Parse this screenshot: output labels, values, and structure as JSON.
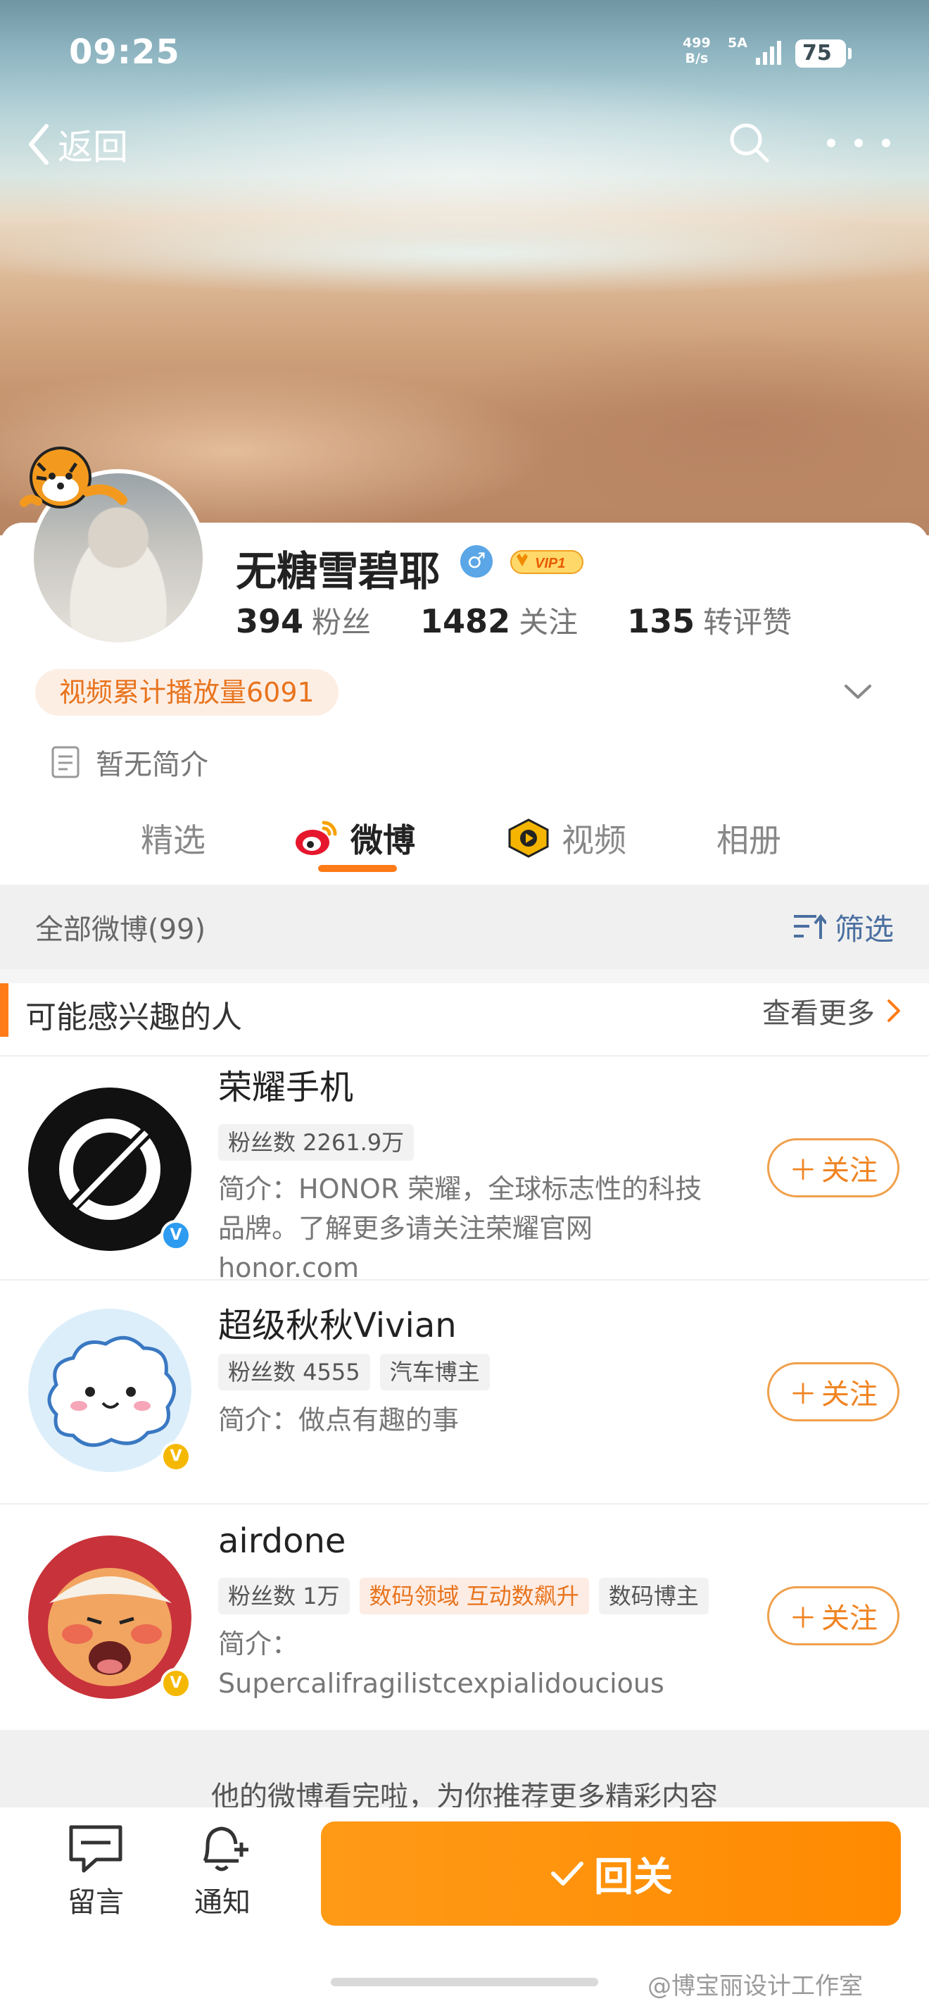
{
  "status_bar": {
    "time": "09:25",
    "net_speed_value": "499",
    "net_speed_unit": "B/s",
    "network": "5A",
    "battery": "75"
  },
  "nav": {
    "back_label": "返回"
  },
  "profile": {
    "name": "无糖雪碧耶",
    "vip_label": "VIP1",
    "stats": [
      {
        "num": "394",
        "label": "粉丝"
      },
      {
        "num": "1482",
        "label": "关注"
      },
      {
        "num": "135",
        "label": "转评赞"
      }
    ],
    "video_badge": "视频累计播放量6091",
    "bio": "暂无简介"
  },
  "tabs": [
    {
      "label": "精选"
    },
    {
      "label": "微博"
    },
    {
      "label": "视频"
    },
    {
      "label": "相册"
    }
  ],
  "filter_bar": {
    "count": "全部微博(99)",
    "filter_label": "筛选"
  },
  "recommendations": {
    "title": "可能感兴趣的人",
    "more_label": "查看更多",
    "items": [
      {
        "name": "荣耀手机",
        "tags": [
          "粉丝数 2261.9万"
        ],
        "desc": "简介：HONOR 荣耀，全球标志性的科技品牌。了解更多请关注荣耀官网honor.com",
        "follow_label": "关注"
      },
      {
        "name": "超级秋秋Vivian",
        "tags": [
          "粉丝数 4555",
          "汽车博主"
        ],
        "desc": "简介：做点有趣的事",
        "follow_label": "关注"
      },
      {
        "name": "airdone",
        "tags": [
          "粉丝数 1万",
          "数码领域 互动数飙升",
          "数码博主"
        ],
        "desc": "简介：Supercalifragilistcexpialidoucious",
        "follow_label": "关注"
      }
    ]
  },
  "footer": {
    "hint": "他的微博看完啦，为你推荐更多精彩内容"
  },
  "bottom_bar": {
    "comment_label": "留言",
    "notify_label": "通知",
    "follow_back_label": "回关"
  },
  "watermark": "@博宝丽设计工作室",
  "colors": {
    "accent": "#ff7b17",
    "follow_border": "#f0a04b",
    "verify_blue": "#2d9bf0",
    "verify_gold": "#f5b800",
    "filter_blue": "#4a6fa0"
  }
}
